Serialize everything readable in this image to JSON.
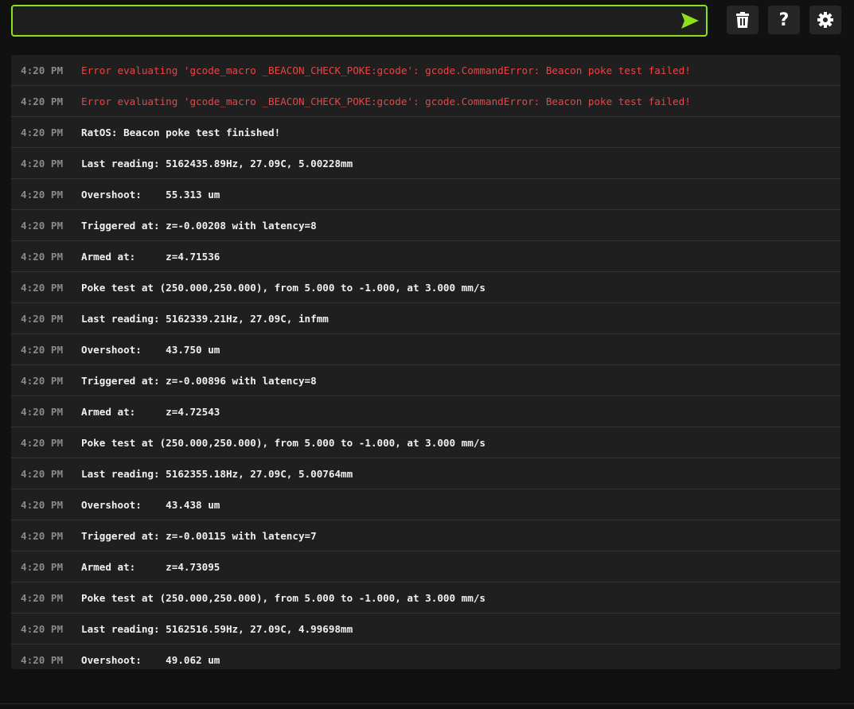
{
  "command_input": {
    "value": "",
    "placeholder": ""
  },
  "toolbar": {
    "send_icon": "send-icon",
    "clear_icon": "trash-icon",
    "help_icon": "help-icon",
    "settings_icon": "gear-icon"
  },
  "colors": {
    "accent": "#8fe01c",
    "error": "#e84545"
  },
  "log": [
    {
      "time": "4:20 PM",
      "text": "Error evaluating 'gcode_macro _BEACON_CHECK_POKE:gcode': gcode.CommandError: Beacon poke test failed!",
      "error": true
    },
    {
      "time": "4:20 PM",
      "text": "Error evaluating 'gcode_macro _BEACON_CHECK_POKE:gcode': gcode.CommandError: Beacon poke test failed!",
      "error": true
    },
    {
      "time": "4:20 PM",
      "text": "RatOS: Beacon poke test finished!"
    },
    {
      "time": "4:20 PM",
      "text": "Last reading: 5162435.89Hz, 27.09C, 5.00228mm"
    },
    {
      "time": "4:20 PM",
      "text": "Overshoot:    55.313 um"
    },
    {
      "time": "4:20 PM",
      "text": "Triggered at: z=-0.00208 with latency=8"
    },
    {
      "time": "4:20 PM",
      "text": "Armed at:     z=4.71536"
    },
    {
      "time": "4:20 PM",
      "text": "Poke test at (250.000,250.000), from 5.000 to -1.000, at 3.000 mm/s"
    },
    {
      "time": "4:20 PM",
      "text": "Last reading: 5162339.21Hz, 27.09C, infmm"
    },
    {
      "time": "4:20 PM",
      "text": "Overshoot:    43.750 um"
    },
    {
      "time": "4:20 PM",
      "text": "Triggered at: z=-0.00896 with latency=8"
    },
    {
      "time": "4:20 PM",
      "text": "Armed at:     z=4.72543"
    },
    {
      "time": "4:20 PM",
      "text": "Poke test at (250.000,250.000), from 5.000 to -1.000, at 3.000 mm/s"
    },
    {
      "time": "4:20 PM",
      "text": "Last reading: 5162355.18Hz, 27.09C, 5.00764mm"
    },
    {
      "time": "4:20 PM",
      "text": "Overshoot:    43.438 um"
    },
    {
      "time": "4:20 PM",
      "text": "Triggered at: z=-0.00115 with latency=7"
    },
    {
      "time": "4:20 PM",
      "text": "Armed at:     z=4.73095"
    },
    {
      "time": "4:20 PM",
      "text": "Poke test at (250.000,250.000), from 5.000 to -1.000, at 3.000 mm/s"
    },
    {
      "time": "4:20 PM",
      "text": "Last reading: 5162516.59Hz, 27.09C, 4.99698mm"
    },
    {
      "time": "4:20 PM",
      "text": "Overshoot:    49.062 um"
    }
  ]
}
